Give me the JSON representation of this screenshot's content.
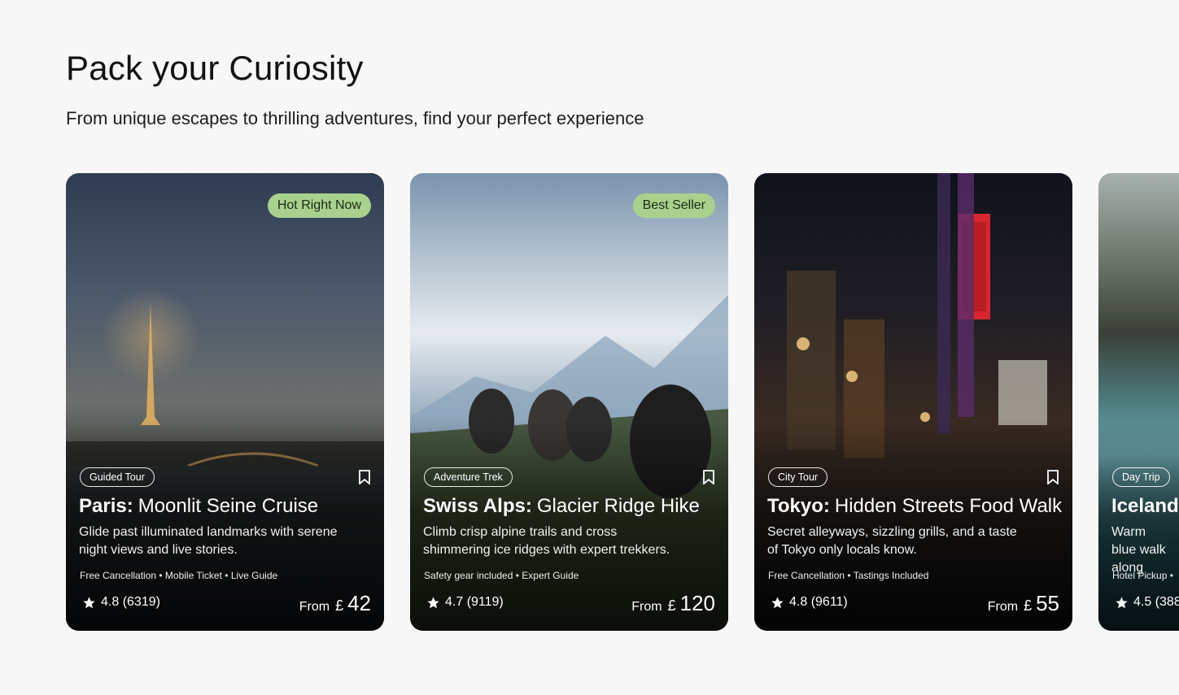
{
  "section": {
    "title": "Pack your Curiosity",
    "subtitle": "From unique escapes to thrilling adventures, find your perfect experience"
  },
  "cards": [
    {
      "badge": "Hot Right Now",
      "category": "Guided Tour",
      "city": "Paris:",
      "name": "Moonlit Seine Cruise",
      "description": "Glide past illuminated landmarks with serene night views and live stories.",
      "features": "Free Cancellation • Mobile Ticket • Live Guide",
      "rating": "4.8 (6319)",
      "from_label": "From",
      "currency": "£",
      "price": "42",
      "icons": [
        "bookmark-icon",
        "star-icon"
      ]
    },
    {
      "badge": "Best Seller",
      "category": "Adventure Trek",
      "city": "Swiss Alps:",
      "name": "Glacier Ridge Hike",
      "description": "Climb crisp alpine trails and cross shimmering ice ridges with expert trekkers.",
      "features": "Safety gear included • Expert Guide",
      "rating": "4.7 (9119)",
      "from_label": "From",
      "currency": "£",
      "price": "120",
      "icons": [
        "bookmark-icon",
        "star-icon"
      ]
    },
    {
      "badge": "",
      "category": "City Tour",
      "city": "Tokyo:",
      "name": "Hidden Streets Food Walk",
      "description": "Secret alleyways, sizzling grills, and a taste of Tokyo only locals know.",
      "features": "Free Cancellation • Tastings Included",
      "rating": "4.8 (9611)",
      "from_label": "From",
      "currency": "£",
      "price": "55",
      "icons": [
        "bookmark-icon",
        "star-icon"
      ]
    },
    {
      "badge": "",
      "category": "Day Trip",
      "city": "Iceland:",
      "name": "",
      "description": "Warm blue walk along",
      "features": "Hotel Pickup •",
      "rating": "4.5 (388",
      "icons": [
        "star-icon"
      ]
    }
  ],
  "colors": {
    "page_background": "#f7f7f7",
    "badge_background": "#a9d18e"
  }
}
